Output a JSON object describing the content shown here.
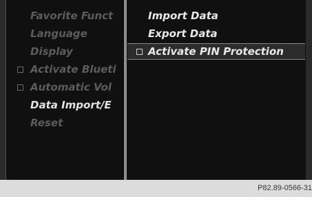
{
  "left_menu": {
    "items": [
      {
        "label": "Favorite Funct",
        "state": "inactive",
        "checkbox": false
      },
      {
        "label": "Language",
        "state": "inactive",
        "checkbox": false
      },
      {
        "label": "Display",
        "state": "inactive",
        "checkbox": false
      },
      {
        "label": "Activate Blueti",
        "state": "inactive",
        "checkbox": true
      },
      {
        "label": "Automatic Vol",
        "state": "inactive",
        "checkbox": true
      },
      {
        "label": "Data Import/E",
        "state": "active",
        "checkbox": false
      },
      {
        "label": "Reset",
        "state": "inactive",
        "checkbox": false
      }
    ]
  },
  "right_menu": {
    "items": [
      {
        "label": "Import Data",
        "selected": false,
        "checkbox": false
      },
      {
        "label": "Export Data",
        "selected": false,
        "checkbox": false
      },
      {
        "label": "Activate PIN Protection",
        "selected": true,
        "checkbox": true
      }
    ]
  },
  "caption": "P82.89-0566-31",
  "colors": {
    "background": "#101010",
    "active_text": "#e3e3e3",
    "inactive_text": "#5c5c5c",
    "divider": "#8f8f8f",
    "caption_bar": "#dcdcdc"
  }
}
